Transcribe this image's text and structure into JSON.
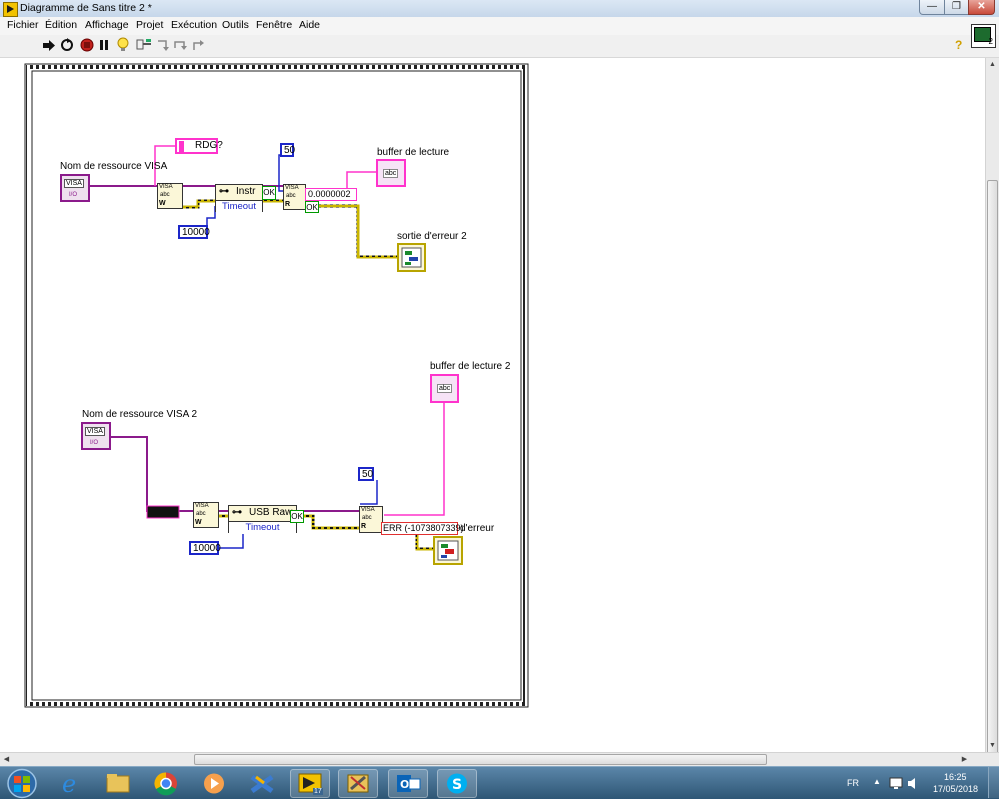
{
  "window": {
    "title": "Diagramme de Sans titre 2 *",
    "min_glyph": "—",
    "max_glyph": "❐",
    "close_glyph": "✕"
  },
  "menu": [
    "Fichier",
    "Édition",
    "Affichage",
    "Projet",
    "Exécution",
    "Outils",
    "Fenêtre",
    "Aide"
  ],
  "toolbar": {
    "icons": [
      "run-arrow-icon",
      "highlight-execution-icon",
      "abort-icon",
      "pause-icon",
      "lightbulb-icon",
      "retain-wire-values-icon",
      "step-into-icon",
      "step-over-icon",
      "step-out-icon"
    ],
    "help_glyph": "?",
    "connector_pane_number": "2"
  },
  "diagram": {
    "top": {
      "resource_label": "Nom de ressource VISA",
      "resource_icon_text": "VISA",
      "resource_icon_sub": "I/O",
      "write_string": "RDG?",
      "count_constant": "50",
      "timeout_constant": "10000",
      "property_class": "Instr",
      "property_name": "Timeout",
      "status_ok": "OK",
      "read_probe_value": "0.0000002",
      "read_status_ok": "OK",
      "buffer_label": "buffer de lecture",
      "buffer_icon_text": "abc",
      "error_out_label": "sortie d'erreur 2",
      "write_node_text": "VISA",
      "write_node_sub": "abc",
      "read_node_text": "VISA",
      "read_node_sub": "abc",
      "w_letter": "W",
      "r_letter": "R"
    },
    "bottom": {
      "resource_label": "Nom de ressource VISA 2",
      "resource_icon_text": "VISA",
      "resource_icon_sub": "I/O",
      "count_constant": "50",
      "timeout_constant": "10000",
      "property_class": "USB Raw",
      "property_name": "Timeout",
      "status_ok": "OK",
      "error_probe": "ERR (-1073807339)",
      "error_out_label": "d'erreur",
      "buffer_label": "buffer de lecture 2",
      "buffer_icon_text": "abc",
      "write_node_text": "VISA",
      "write_node_sub": "abc",
      "read_node_text": "VISA",
      "read_node_sub": "abc",
      "w_letter": "W",
      "r_letter": "R"
    }
  },
  "taskbar": {
    "apps": [
      "start-button",
      "internet-explorer",
      "file-explorer",
      "chrome",
      "media-player",
      "vpn-client",
      "labview",
      "labview-tools",
      "outlook",
      "skype"
    ],
    "labview_badge": "17",
    "language": "FR",
    "time": "16:25",
    "date": "17/05/2018"
  },
  "colors": {
    "string_wire": "#ff33cc",
    "int_wire": "#1c26c8",
    "visa_wire": "#8b1a8b",
    "error_wire": "#c8b400",
    "label_text": "#000000"
  }
}
